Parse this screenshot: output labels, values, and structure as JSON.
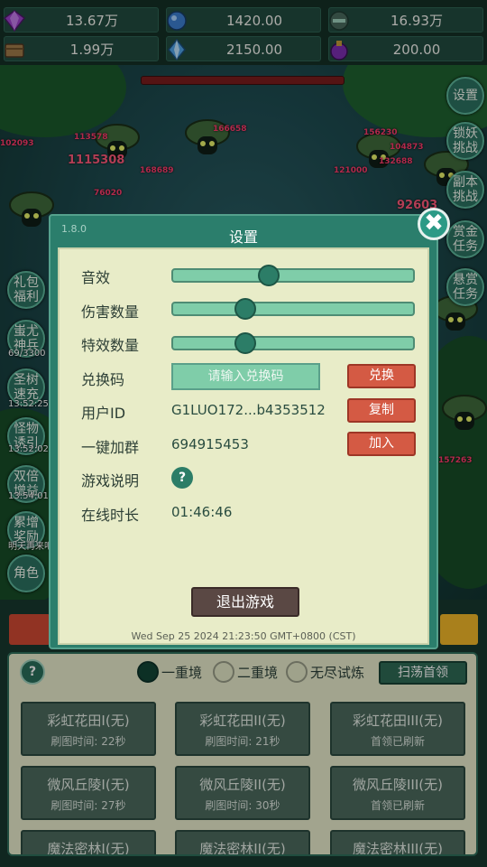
{
  "resources": [
    {
      "icon": "amethyst-gem-icon",
      "value": "13.67万"
    },
    {
      "icon": "blue-orb-icon",
      "value": "1420.00"
    },
    {
      "icon": "green-orb-icon",
      "value": "16.93万"
    },
    {
      "icon": "wood-chest-icon",
      "value": "1.99万"
    },
    {
      "icon": "blue-crystal-icon",
      "value": "2150.00"
    },
    {
      "icon": "purple-flask-icon",
      "value": "200.00"
    }
  ],
  "scene": {
    "damage_numbers": [
      "1115308",
      "113578",
      "102093",
      "76020",
      "168689",
      "166658",
      "156230",
      "132688",
      "121000",
      "92603",
      "104873",
      "157263"
    ],
    "timers": [
      "13:52:25",
      "13:52:02",
      "13:53:00",
      "13:54:01"
    ],
    "capture_text": "明天再来吧",
    "right_buttons": [
      {
        "label": "设置"
      },
      {
        "label": "锁妖挑战"
      },
      {
        "label": "副本挑战"
      },
      {
        "label": "赏金任务"
      },
      {
        "label": "悬赏任务"
      }
    ],
    "left_buttons": [
      {
        "label": "礼包福利"
      },
      {
        "label": "蚩尤神兵"
      },
      {
        "label": "圣树速充"
      },
      {
        "label": "怪物诱引"
      },
      {
        "label": "双倍增益"
      },
      {
        "label": "累增奖励"
      },
      {
        "label": "角色"
      }
    ],
    "counter": "69/3300"
  },
  "bottom": {
    "help_label": "?",
    "modes": [
      {
        "label": "一重境",
        "selected": true
      },
      {
        "label": "二重境",
        "selected": false
      },
      {
        "label": "无尽试炼",
        "selected": false
      }
    ],
    "sweep_label": "扫荡首领",
    "stages": [
      {
        "name": "彩虹花田I(无)",
        "info": "刷图时间: 22秒"
      },
      {
        "name": "彩虹花田II(无)",
        "info": "刷图时间: 21秒"
      },
      {
        "name": "彩虹花田III(无)",
        "info": "首领已刷新"
      },
      {
        "name": "微风丘陵I(无)",
        "info": "刷图时间: 27秒"
      },
      {
        "name": "微风丘陵II(无)",
        "info": "刷图时间: 30秒"
      },
      {
        "name": "微风丘陵III(无)",
        "info": "首领已刷新"
      },
      {
        "name": "魔法密林I(无)",
        "info": ""
      },
      {
        "name": "魔法密林II(无)",
        "info": ""
      },
      {
        "name": "魔法密林III(无)",
        "info": ""
      }
    ]
  },
  "dialog": {
    "version": "1.8.0",
    "title": "设置",
    "close_label": "✖",
    "sound_label": "音效",
    "sound_level": 0.4,
    "damage_count_label": "伤害数量",
    "damage_count_level": 0.3,
    "effects_count_label": "特效数量",
    "effects_count_level": 0.3,
    "redeem_label": "兑换码",
    "redeem_placeholder": "请输入兑换码",
    "redeem_button": "兑换",
    "user_id_label": "用户ID",
    "user_id_value": "G1LUO172...b4353512",
    "copy_button": "复制",
    "group_label": "一键加群",
    "group_value": "694915453",
    "join_button": "加入",
    "help_label": "游戏说明",
    "help_button": "?",
    "online_label": "在线时长",
    "online_value": "01:46:46",
    "exit_button": "退出游戏",
    "datetime": "Wed Sep 25 2024 21:23:50 GMT+0800 (CST)"
  },
  "colors": {
    "accent_green": "#2b7e6c",
    "panel_cream": "#e8ecc8",
    "danger_red": "#d45a44"
  }
}
